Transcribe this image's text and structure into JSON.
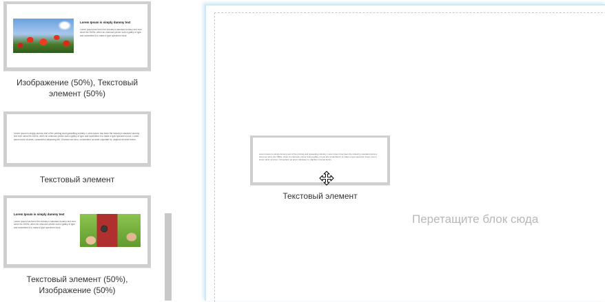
{
  "sidebar": {
    "blocks": [
      {
        "caption": "Изображение (50%), Текстовый элемент (50%)",
        "preview_heading": "Lorem Ipsum is simply dummy text",
        "preview_text": "Lorem Ipsum has been the industry's standard dummy text ever since the 1500s, when an unknown printer took a galley of type and scrambled it to make a type specimen book."
      },
      {
        "caption": "Текстовый элемент",
        "preview_text": "Lorem Ipsum is simply dummy text of the printing and typesetting industry. Lorem Ipsum has been the industry's standard dummy text ever since the 1500s, when an unknown printer took a galley of type and scrambled it to make a type specimen book. Lorem ipsum dolor sit amet, consectetur adipiscing elit. Vivamus nec arcu, consectetur ac amet vulputate mi, dapibus sit amet lectus."
      },
      {
        "caption": "Текстовый элемент (50%), Изображение (50%)",
        "preview_heading": "Lorem Ipsum is simply dummy text",
        "preview_text": "Lorem Ipsum has been the industry's standard dummy text ever since the 1500s, when an unknown printer took a galley of type and scrambled it to make a type specimen book."
      }
    ]
  },
  "canvas": {
    "drop_hint": "Перетащите блок сюда",
    "dragged_block": {
      "caption": "Текстовый элемент",
      "preview_text": "Lorem Ipsum is simply dummy text of the printing and typesetting industry. Lorem Ipsum has been the industry's standard dummy text ever since the 1500s, when an unknown printer took a galley of type and scrambled it to make a type specimen book. Lorem ipsum dolor sit amet, consectetur ac amet vulputate mi, dapibus sit amet lectus."
    }
  },
  "icons": {
    "cursor": "move-cursor-icon"
  },
  "colors": {
    "thumb_frame": "#cfcfcf",
    "canvas_glow": "#cfe8f6",
    "drop_hint": "#b8b8b8",
    "scroll_thumb": "#c8c8c8"
  }
}
